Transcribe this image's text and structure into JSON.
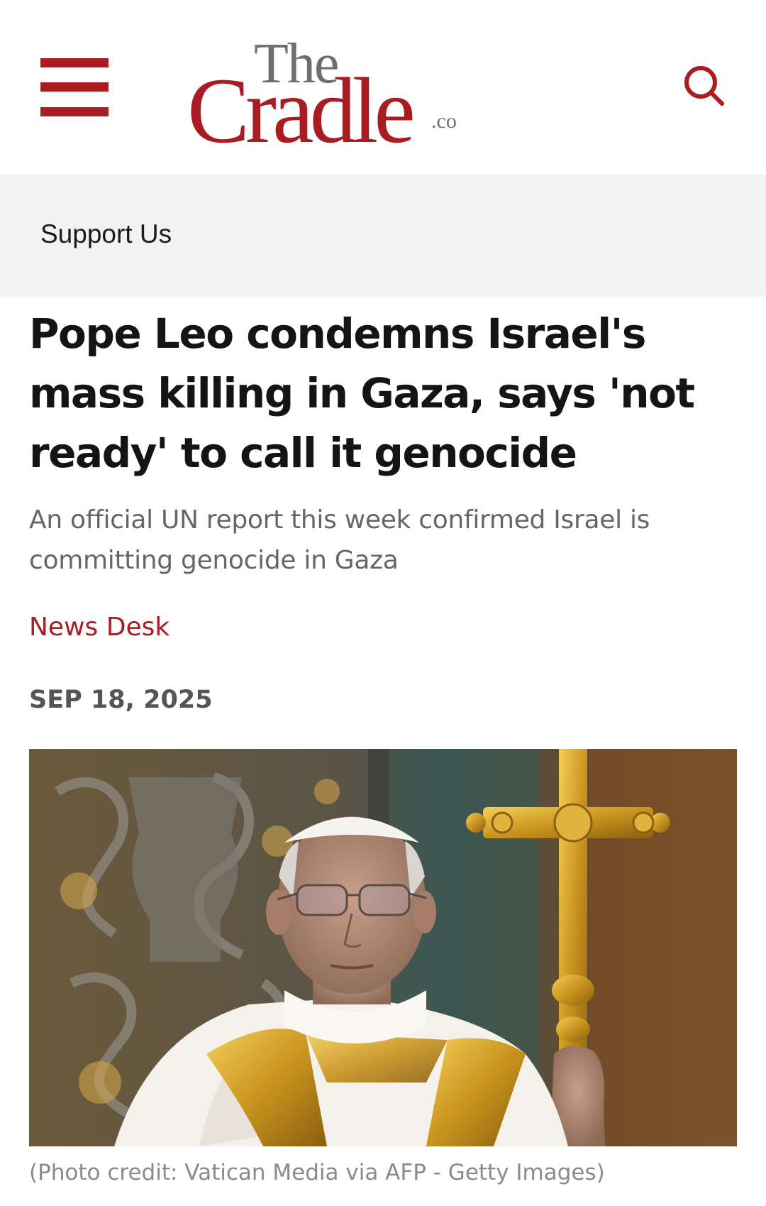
{
  "header": {
    "menu_icon": "hamburger-menu-icon",
    "search_icon": "search-icon",
    "logo": {
      "the": "The",
      "cradle": "Cradle",
      "tld": ".co"
    },
    "brand_color": "#a91d22"
  },
  "support": {
    "label": "Support Us"
  },
  "article": {
    "headline": "Pope Leo condemns Israel's mass killing in Gaza, says 'not ready' to call it genocide",
    "subhead": "An official UN report this week confirmed Israel is committing genocide in Gaza",
    "author": "News Desk",
    "date": "SEP 18, 2025",
    "photo_caption": "(Photo credit: Vatican Media via AFP - Getty Images)"
  }
}
